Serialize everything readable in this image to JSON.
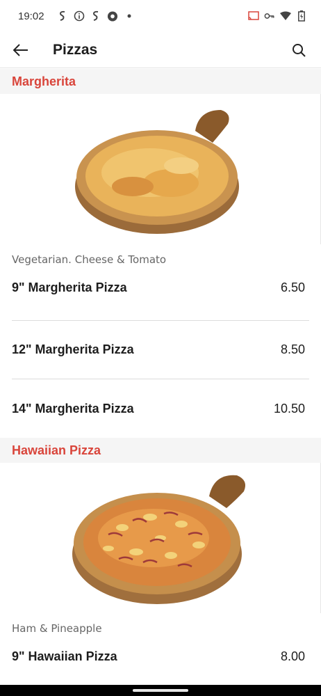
{
  "status": {
    "time": "19:02",
    "left_icons": [
      "swiggy-icon",
      "info-icon",
      "swiggy-icon",
      "chrome-icon",
      "dot-icon"
    ],
    "right_icons": [
      "cast-icon",
      "key-icon",
      "wifi-icon",
      "battery-icon"
    ]
  },
  "appbar": {
    "title": "Pizzas"
  },
  "sections": [
    {
      "title": "Margherita",
      "description": "Vegetarian. Cheese & Tomato",
      "items": [
        {
          "name": "9\" Margherita Pizza",
          "price": "6.50"
        },
        {
          "name": "12\" Margherita Pizza",
          "price": "8.50"
        },
        {
          "name": "14\" Margherita Pizza",
          "price": "10.50"
        }
      ]
    },
    {
      "title": "Hawaiian Pizza",
      "description": "Ham & Pineapple",
      "items": [
        {
          "name": "9\" Hawaiian Pizza",
          "price": "8.00"
        }
      ]
    }
  ],
  "colors": {
    "accent": "#d9453b",
    "section_bg": "#f5f5f5"
  }
}
